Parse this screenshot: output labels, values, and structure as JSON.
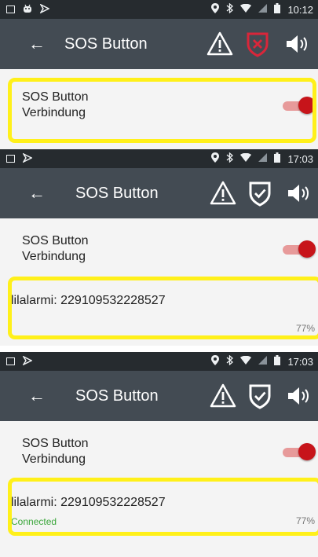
{
  "panels": [
    {
      "status_time": "10:12",
      "title": "SOS Button",
      "shield_state": "disconnected",
      "sos_label_line1": "SOS Button",
      "sos_label_line2": "Verbindung",
      "toggle_on": true
    },
    {
      "status_time": "17:03",
      "title": "SOS Button",
      "shield_state": "connected",
      "sos_label_line1": "SOS Button",
      "sos_label_line2": "Verbindung",
      "toggle_on": true,
      "device_name": "lilalarmi: 229109532228527",
      "device_status": "",
      "battery": "77%"
    },
    {
      "status_time": "17:03",
      "title": "SOS Button",
      "shield_state": "connected",
      "sos_label_line1": "SOS Button",
      "sos_label_line2": "Verbindung",
      "toggle_on": true,
      "device_name": "lilalarmi: 229109532228527",
      "device_status": "Connected",
      "battery": "77%"
    }
  ],
  "icons": {
    "back": "arrow-back-icon",
    "warning": "warning-icon",
    "shield_disconnected": "shield-x-icon",
    "shield_connected": "shield-check-icon",
    "volume": "volume-icon"
  },
  "colors": {
    "highlight": "#fff01a",
    "toggle_knob": "#c7141a",
    "shield_alert": "#d9263a",
    "connected_text": "#3aa63a",
    "app_bar": "#434b53",
    "status_bar": "#262b2f"
  }
}
